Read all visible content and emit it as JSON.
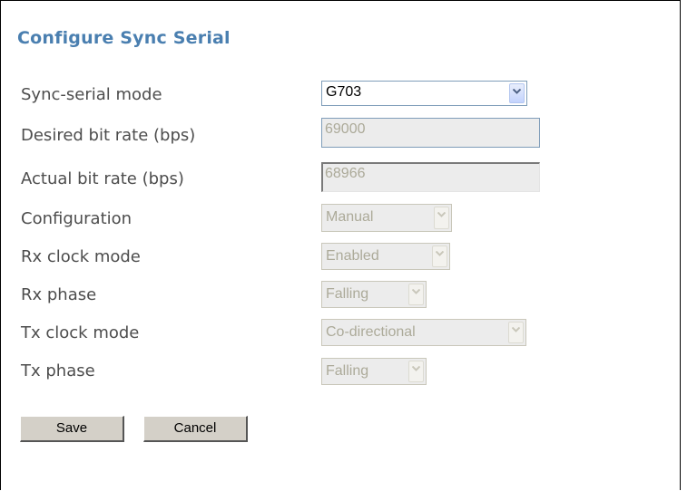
{
  "page": {
    "title": "Configure Sync Serial"
  },
  "fields": {
    "sync_serial_mode": {
      "label": "Sync-serial mode",
      "value": "G703"
    },
    "desired_bit_rate": {
      "label": "Desired bit rate (bps)",
      "value": "69000"
    },
    "actual_bit_rate": {
      "label": "Actual bit rate (bps)",
      "value": "68966"
    },
    "configuration": {
      "label": "Configuration",
      "value": "Manual"
    },
    "rx_clock_mode": {
      "label": "Rx clock mode",
      "value": "Enabled"
    },
    "rx_phase": {
      "label": "Rx phase",
      "value": "Falling"
    },
    "tx_clock_mode": {
      "label": "Tx clock mode",
      "value": "Co-directional"
    },
    "tx_phase": {
      "label": "Tx phase",
      "value": "Falling"
    }
  },
  "buttons": {
    "save": "Save",
    "cancel": "Cancel"
  },
  "colors": {
    "title": "#4a7fb0",
    "label": "#4d4d4d",
    "disabled_text": "#acaa99",
    "button_face": "#d4d0c8"
  },
  "icons": {
    "dropdown": "chevron-down-icon"
  }
}
